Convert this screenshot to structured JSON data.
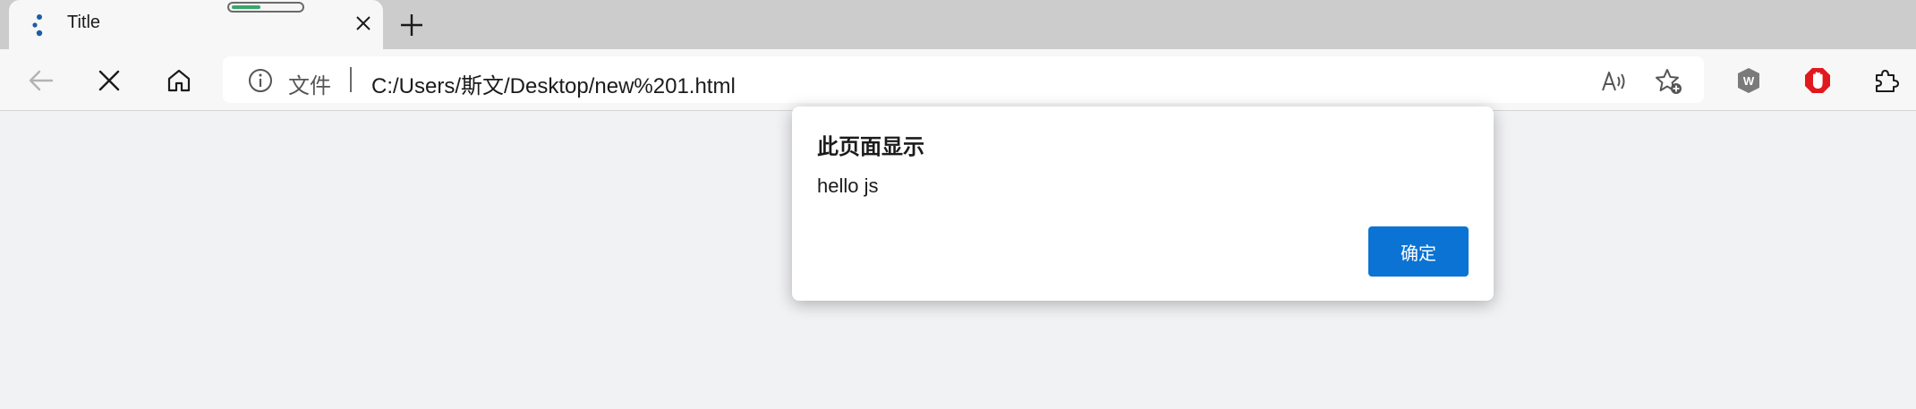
{
  "tab": {
    "title": "Title",
    "favicon": "loading-spinner-icon"
  },
  "toolbar": {
    "back_icon": "arrow-left-icon",
    "stop_icon": "close-icon",
    "home_icon": "home-icon"
  },
  "address": {
    "info_icon": "info-icon",
    "scheme_label": "文件",
    "url": "C:/Users/斯文/Desktop/new%201.html",
    "read_aloud_icon": "read-aloud-icon",
    "favorite_icon": "star-add-icon"
  },
  "extensions": {
    "items": [
      "w-extension-icon",
      "adblock-hand-icon",
      "puzzle-extensions-icon"
    ]
  },
  "colors": {
    "accent": "#0b73d4",
    "adblock": "#e0191f",
    "loading": "#3aa66a"
  },
  "dialog": {
    "title": "此页面显示",
    "message": "hello js",
    "ok_label": "确定"
  }
}
